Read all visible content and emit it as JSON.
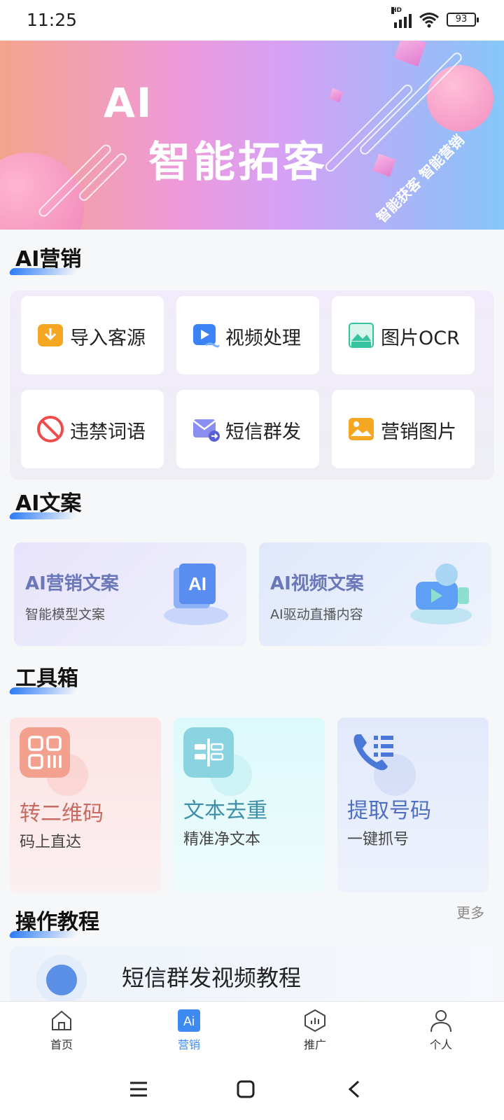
{
  "status_bar": {
    "time": "11:25",
    "network": "HD",
    "battery": "93"
  },
  "banner": {
    "line1": "AI",
    "line2": "智能拓客",
    "tag": "智能获客 智能营销"
  },
  "sections": {
    "ai_marketing": "AI营销",
    "ai_copy": "AI文案",
    "toolbox": "工具箱",
    "tutorial": "操作教程"
  },
  "ai_marketing": [
    {
      "label": "导入客源",
      "icon": "import-icon",
      "color": "#f5a623"
    },
    {
      "label": "视频处理",
      "icon": "video-icon",
      "color": "#3b82f6"
    },
    {
      "label": "图片OCR",
      "icon": "ocr-icon",
      "color": "#36c3a0"
    },
    {
      "label": "违禁词语",
      "icon": "forbidden-icon",
      "color": "#ef4b4b"
    },
    {
      "label": "短信群发",
      "icon": "sms-icon",
      "color": "#6b6fe0"
    },
    {
      "label": "营销图片",
      "icon": "image-icon",
      "color": "#f5a623"
    }
  ],
  "ai_copy": [
    {
      "title": "AI营销文案",
      "subtitle": "智能模型文案"
    },
    {
      "title": "AI视频文案",
      "subtitle": "AI驱动直播内容"
    }
  ],
  "toolbox": [
    {
      "title": "转二维码",
      "subtitle": "码上直达",
      "color": "#d0695a"
    },
    {
      "title": "文本去重",
      "subtitle": "精准净文本",
      "color": "#3f8fa8"
    },
    {
      "title": "提取号码",
      "subtitle": "一键抓号",
      "color": "#4f6fc1"
    }
  ],
  "tutorial": {
    "more": "更多",
    "first_item": "短信群发视频教程"
  },
  "bottom_nav": [
    {
      "label": "首页"
    },
    {
      "label": "营销"
    },
    {
      "label": "推广"
    },
    {
      "label": "个人"
    }
  ],
  "active_tab": "营销"
}
